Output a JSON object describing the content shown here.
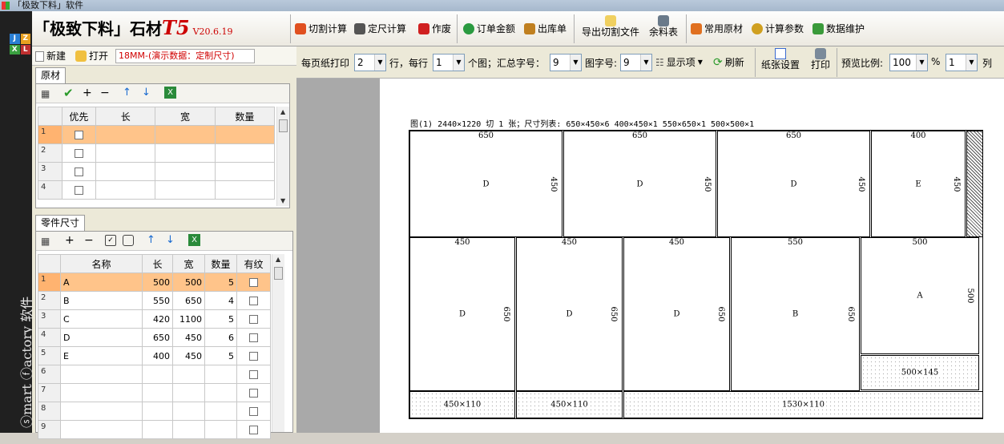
{
  "window": {
    "title": "「极致下料」软件"
  },
  "sidebar": {
    "logo_letters": [
      "J",
      "Z",
      "X",
      "L"
    ],
    "brand_vertical": "ⓢmart ⓕactory 软件"
  },
  "brand": {
    "name": "「极致下料」石材",
    "product": "T5",
    "version": "V20.6.19"
  },
  "toolbar": {
    "cut_calc": "切割计算",
    "fixed_calc": "定尺计算",
    "void": "作废",
    "order_amount": "订单金额",
    "outbound": "出库单",
    "export_cut": "导出切割文件",
    "remnant": "余料表",
    "common_material": "常用原材",
    "calc_params": "计算参数",
    "data_maint": "数据维护"
  },
  "filebar": {
    "new": "新建",
    "open": "打开",
    "file_label": "18MM-(演示数据：定制尺寸)"
  },
  "raw_panel": {
    "tab": "原材",
    "columns": [
      "优先",
      "长",
      "宽",
      "数量"
    ],
    "rows": [
      {
        "n": "1"
      },
      {
        "n": "2"
      },
      {
        "n": "3"
      },
      {
        "n": "4"
      }
    ]
  },
  "parts_panel": {
    "tab": "零件尺寸",
    "columns": [
      "名称",
      "长",
      "宽",
      "数量",
      "有纹"
    ],
    "rows": [
      {
        "n": "1",
        "name": "A",
        "l": "500",
        "w": "500",
        "q": "5"
      },
      {
        "n": "2",
        "name": "B",
        "l": "550",
        "w": "650",
        "q": "4"
      },
      {
        "n": "3",
        "name": "C",
        "l": "420",
        "w": "1100",
        "q": "5"
      },
      {
        "n": "4",
        "name": "D",
        "l": "650",
        "w": "450",
        "q": "6"
      },
      {
        "n": "5",
        "name": "E",
        "l": "400",
        "w": "450",
        "q": "5"
      },
      {
        "n": "6",
        "name": "",
        "l": "",
        "w": "",
        "q": ""
      },
      {
        "n": "7",
        "name": "",
        "l": "",
        "w": "",
        "q": ""
      },
      {
        "n": "8",
        "name": "",
        "l": "",
        "w": "",
        "q": ""
      },
      {
        "n": "9",
        "name": "",
        "l": "",
        "w": "",
        "q": ""
      }
    ]
  },
  "options": {
    "per_page": "每页纸打印",
    "per_page_val": "2",
    "rows": "行，每行",
    "rows_val": "1",
    "per_fig": "个图；汇总字号：",
    "sum_font_val": "9",
    "fig_font": "图字号:",
    "fig_font_val": "9",
    "display": "显示项",
    "refresh": "刷新",
    "paper_setup": "纸张设置",
    "print": "打印",
    "zoom_label": "预览比例:",
    "zoom_val": "100",
    "percent": "%",
    "cols_val": "1",
    "cols_unit": "列"
  },
  "preview": {
    "fig_title": "图(1) 2440×1220 切 1 张；尺寸列表: 650×450×6 400×450×1 550×650×1 500×500×1",
    "pieces": [
      {
        "w": "650",
        "h": "450",
        "n": "D"
      },
      {
        "w": "650",
        "h": "450",
        "n": "D"
      },
      {
        "w": "650",
        "h": "450",
        "n": "D"
      },
      {
        "w": "400",
        "h": "450",
        "n": "E"
      },
      {
        "w": "450",
        "h": "650",
        "n": "D"
      },
      {
        "w": "450",
        "h": "650",
        "n": "D"
      },
      {
        "w": "450",
        "h": "650",
        "n": "D"
      },
      {
        "w": "550",
        "h": "650",
        "n": "B"
      },
      {
        "w": "500",
        "h": "500",
        "n": "A"
      }
    ],
    "remnants": [
      "500×145",
      "450×110",
      "450×110",
      "1530×110"
    ]
  }
}
